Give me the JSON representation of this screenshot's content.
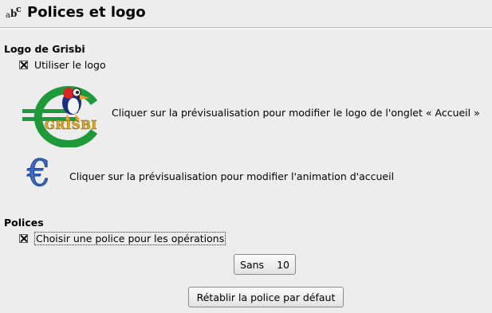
{
  "header": {
    "icon": "abc-font-icon",
    "icon_letters": {
      "a": "a",
      "b": "b",
      "c": "c"
    },
    "title": "Polices et logo"
  },
  "logo_section": {
    "title": "Logo de Grisbi",
    "use_logo_checkbox": {
      "label": "Utiliser le logo",
      "checked": true
    },
    "logo_preview": {
      "icon": "grisbi-logo",
      "text": "GRISBI"
    },
    "logo_hint": "Cliquer sur la prévisualisation pour modifier le logo de l'onglet « Accueil »",
    "animation_preview": {
      "icon": "euro-icon",
      "glyph": "€"
    },
    "animation_hint": "Cliquer sur la prévisualisation pour modifier l'animation d'accueil"
  },
  "fonts_section": {
    "title": "Polices",
    "choose_font_checkbox": {
      "label": "Choisir une police pour les opérations",
      "checked": true
    },
    "font_button": {
      "family": "Sans",
      "size": "10"
    },
    "reset_button_label": "Rétablir la police par défaut"
  },
  "colors": {
    "background": "#ededed",
    "logo_green": "#1f9a3a",
    "logo_gold": "#e3b21a",
    "euro_blue": "#3a6fc9"
  }
}
